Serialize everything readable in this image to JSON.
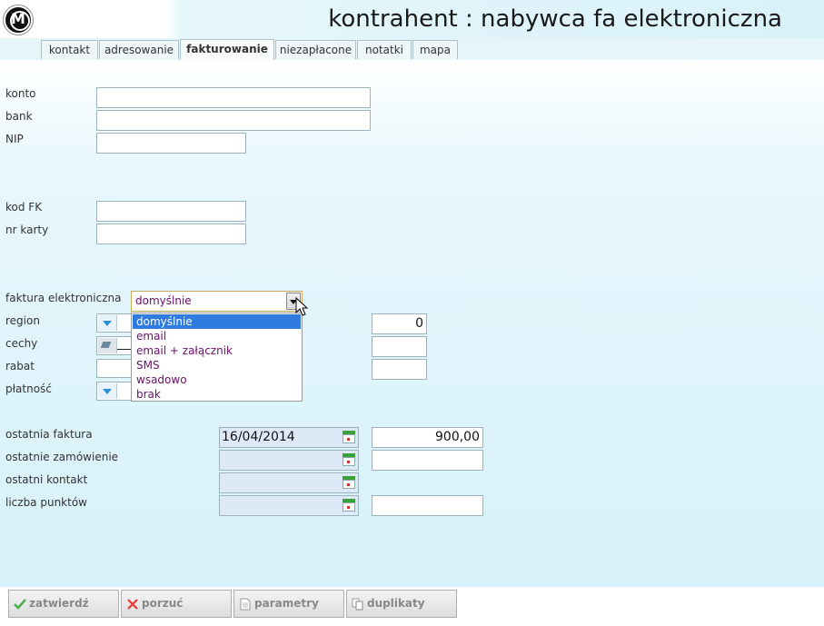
{
  "header": {
    "title": "kontrahent : nabywca fa elektroniczna",
    "logo_letter": "M"
  },
  "tabs": [
    {
      "label": "kontakt"
    },
    {
      "label": "adresowanie"
    },
    {
      "label": "fakturowanie",
      "active": true
    },
    {
      "label": "niezapłacone"
    },
    {
      "label": "notatki"
    },
    {
      "label": "mapa"
    }
  ],
  "fields": {
    "konto": {
      "label": "konto",
      "value": ""
    },
    "bank": {
      "label": "bank",
      "value": ""
    },
    "nip": {
      "label": "NIP",
      "value": ""
    },
    "kod_fk": {
      "label": "kod FK",
      "value": ""
    },
    "nr_karty": {
      "label": "nr karty",
      "value": ""
    },
    "faktura_elektroniczna": {
      "label": "faktura elektroniczna",
      "selected": "domyślnie",
      "options": [
        "domyślnie",
        "email",
        "email + załącznik",
        "SMS",
        "wsadowo",
        "brak"
      ]
    },
    "region": {
      "label": "region",
      "right_value": "0"
    },
    "cechy": {
      "label": "cechy"
    },
    "rabat": {
      "label": "rabat"
    },
    "platnosc": {
      "label": "płatność"
    },
    "ostatnia_faktura": {
      "label": "ostatnia faktura",
      "date": "16/04/2014",
      "amount": "900,00"
    },
    "ostatnie_zamowienie": {
      "label": "ostatnie zamówienie",
      "date": "",
      "amount": ""
    },
    "ostatni_kontakt": {
      "label": "ostatni kontakt",
      "date": ""
    },
    "liczba_punktow": {
      "label": "liczba punktów",
      "date": "",
      "amount": ""
    }
  },
  "footer": {
    "zatwierdz": "zatwierdź",
    "porzuc": "porzuć",
    "parametry": "parametry",
    "duplikaty": "duplikaty"
  },
  "colors": {
    "accent": "#2f7be0",
    "background": "#d6f1fa",
    "option_text": "#6b0f6b"
  }
}
